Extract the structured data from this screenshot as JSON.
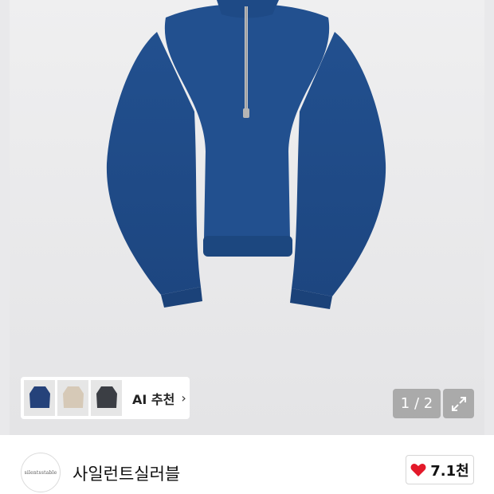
{
  "product": {
    "image_alt": "blue half-zip knit sweater",
    "thumbnails": [
      {
        "icon": "blue-sweater-thumb",
        "color": "#25427a"
      },
      {
        "icon": "beige-sweater-thumb",
        "color": "#d9cdbd"
      },
      {
        "icon": "charcoal-jacket-thumb",
        "color": "#3b3e44"
      }
    ],
    "ai_recommend_label": "AI 추천",
    "ai_chevron": "›",
    "page_counter": "1 / 2"
  },
  "store": {
    "logo_text": "silentsstable",
    "name": "사일런트실러블",
    "like_count": "7.1천"
  },
  "colors": {
    "sweater": "#1f4a8c",
    "heart": "#e3192a"
  }
}
